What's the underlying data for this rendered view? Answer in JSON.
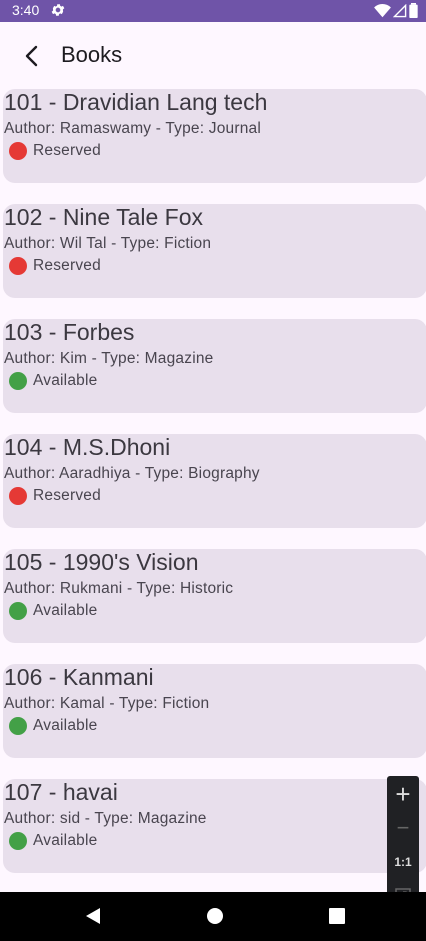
{
  "status_bar": {
    "time": "3:40"
  },
  "app_bar": {
    "title": "Books"
  },
  "books": [
    {
      "title": "101 - Dravidian Lang tech",
      "meta": "Author: Ramaswamy - Type: Journal",
      "status": "Reserved",
      "status_color": "#e53935"
    },
    {
      "title": "102 - Nine Tale Fox",
      "meta": "Author: Wil Tal - Type: Fiction",
      "status": "Reserved",
      "status_color": "#e53935"
    },
    {
      "title": "103 - Forbes",
      "meta": "Author: Kim - Type: Magazine",
      "status": "Available",
      "status_color": "#43a047"
    },
    {
      "title": "104 - M.S.Dhoni",
      "meta": "Author: Aaradhiya - Type: Biography",
      "status": "Reserved",
      "status_color": "#e53935"
    },
    {
      "title": "105 - 1990's Vision",
      "meta": "Author: Rukmani - Type: Historic",
      "status": "Available",
      "status_color": "#43a047"
    },
    {
      "title": "106 - Kanmani",
      "meta": "Author: Kamal - Type: Fiction",
      "status": "Available",
      "status_color": "#43a047"
    },
    {
      "title": "107 - havai",
      "meta": "Author: sid - Type: Magazine",
      "status": "Available",
      "status_color": "#43a047"
    }
  ],
  "zoom_controls": {
    "plus": "+",
    "minus": "−",
    "ratio": "1:1"
  },
  "colors": {
    "status_bar": "#6f54a8",
    "background": "#fef7ff",
    "card": "#e8dfec"
  }
}
